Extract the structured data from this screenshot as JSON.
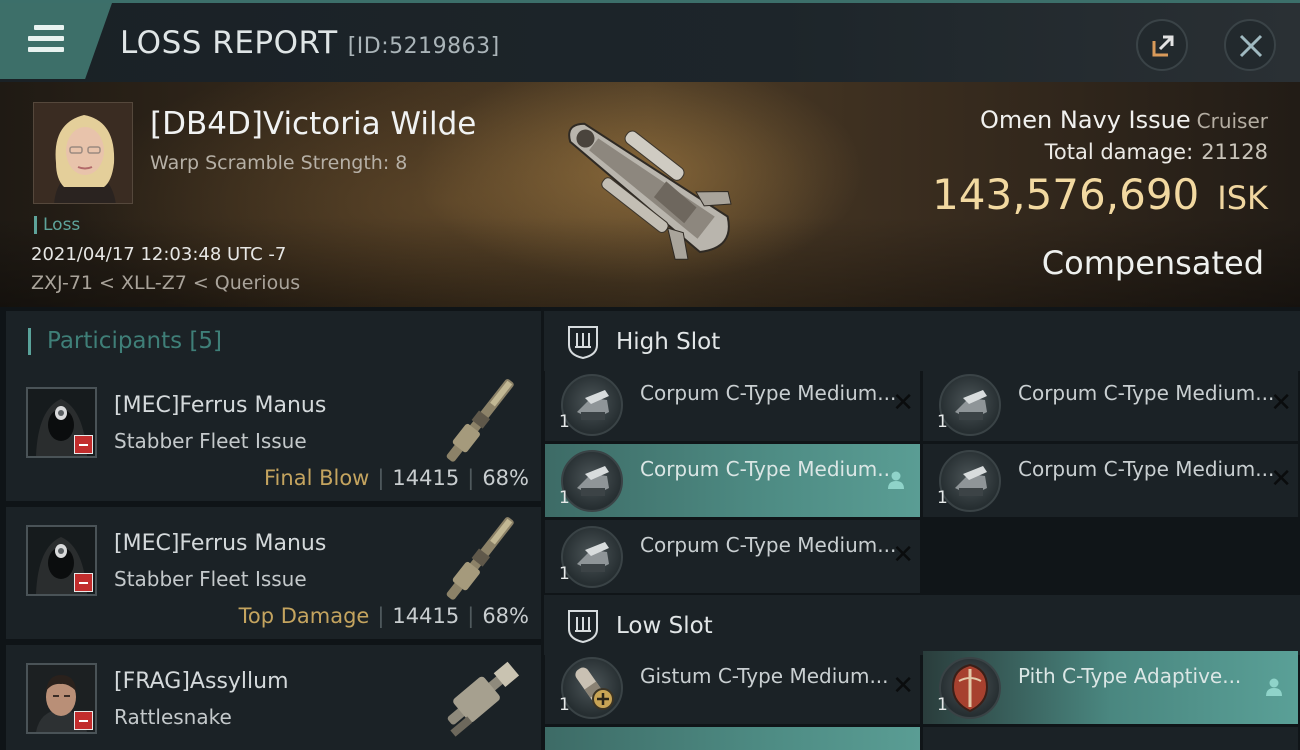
{
  "header": {
    "title": "LOSS REPORT",
    "report_id": "[ID:5219863]"
  },
  "victim": {
    "name": "[DB4D]Victoria Wilde",
    "warp_scramble": "Warp Scramble Strength: 8",
    "tag": "Loss",
    "datetime": "2021/04/17 12:03:48 UTC -7",
    "location": "ZXJ-71 < XLL-Z7 < Querious",
    "ship_name": "Omen Navy Issue",
    "ship_class": "Cruiser",
    "total_damage_label": "Total damage:",
    "total_damage": "21128",
    "isk_value": "143,576,690",
    "isk_unit": "ISK",
    "status": "Compensated"
  },
  "participants": {
    "label": "Participants",
    "count": "[5]",
    "items": [
      {
        "name": "[MEC]Ferrus Manus",
        "ship": "Stabber Fleet Issue",
        "tag": "Final Blow",
        "damage": "14415",
        "percent": "68%"
      },
      {
        "name": "[MEC]Ferrus Manus",
        "ship": "Stabber Fleet Issue",
        "tag": "Top Damage",
        "damage": "14415",
        "percent": "68%"
      },
      {
        "name": "[FRAG]Assyllum",
        "ship": "Rattlesnake"
      }
    ]
  },
  "fitting": {
    "high_slot_label": "High Slot",
    "low_slot_label": "Low Slot",
    "high": [
      {
        "name": "Corpum C-Type Medium...",
        "qty": "1",
        "state": "destroyed"
      },
      {
        "name": "Corpum C-Type Medium...",
        "qty": "1",
        "state": "destroyed"
      },
      {
        "name": "Corpum C-Type Medium...",
        "qty": "1",
        "state": "dropped"
      },
      {
        "name": "Corpum C-Type Medium...",
        "qty": "1",
        "state": "destroyed"
      },
      {
        "name": "Corpum C-Type Medium...",
        "qty": "1",
        "state": "destroyed"
      }
    ],
    "low": [
      {
        "name": "Gistum C-Type Medium...",
        "qty": "1",
        "state": "destroyed"
      },
      {
        "name": "Pith C-Type Adaptive...",
        "qty": "1",
        "state": "dropped"
      }
    ]
  },
  "icons": {
    "destroyed": "close-x-icon",
    "dropped": "person-icon",
    "accent": "#4e8c84",
    "isk_color": "#f2d9a1"
  }
}
